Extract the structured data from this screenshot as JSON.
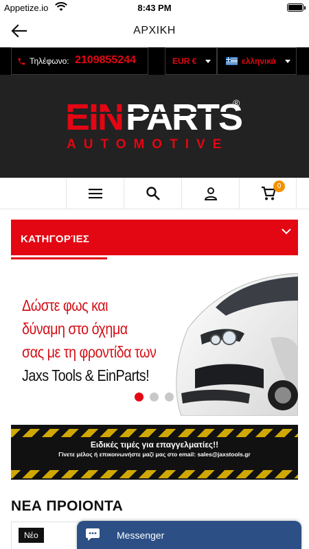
{
  "status_bar": {
    "carrier": "Appetize.io",
    "time": "8:43 PM"
  },
  "header": {
    "title": "ΑΡΧΙΚΗ",
    "back_icon": "arrow-left-icon"
  },
  "top_bar": {
    "phone_label": "Τηλέφωνο:",
    "phone_number": "2109855244",
    "currency": "EUR €",
    "language": "ελληνικά"
  },
  "logo": {
    "brand_part1": "EIN",
    "brand_part2": "PARTS",
    "registered": "®",
    "subtitle": "AUTOMOTIVE"
  },
  "toolbar": {
    "icons": [
      "menu-icon",
      "search-icon",
      "user-icon",
      "cart-icon"
    ],
    "cart_count": "0"
  },
  "categories": {
    "label": "ΚΑΤΗΓΟΡΊΕΣ"
  },
  "banner": {
    "lines": [
      "Δώστε φως και",
      "δύναμη στο όχημα",
      "σας με τη φροντίδα των",
      "Jaxs Tools & EinParts!"
    ],
    "slides": 3,
    "active_slide": 1
  },
  "promo": {
    "title": "Ειδικές τιμές για επαγγελματίες!!",
    "subtitle": "Γίνετε μέλος  ή επικοινωνήστε μαζί μας στο email: sales@jaxstools.gr"
  },
  "new_products": {
    "title": "ΝΕΑ ΠΡΟΙΟΝΤΑ",
    "badge": "Νέο"
  },
  "messenger": {
    "label": "Messenger"
  },
  "colors": {
    "brand_red": "#e30613",
    "dark": "#222222",
    "messenger_blue": "#2c4f86",
    "badge_orange": "#f39200"
  }
}
